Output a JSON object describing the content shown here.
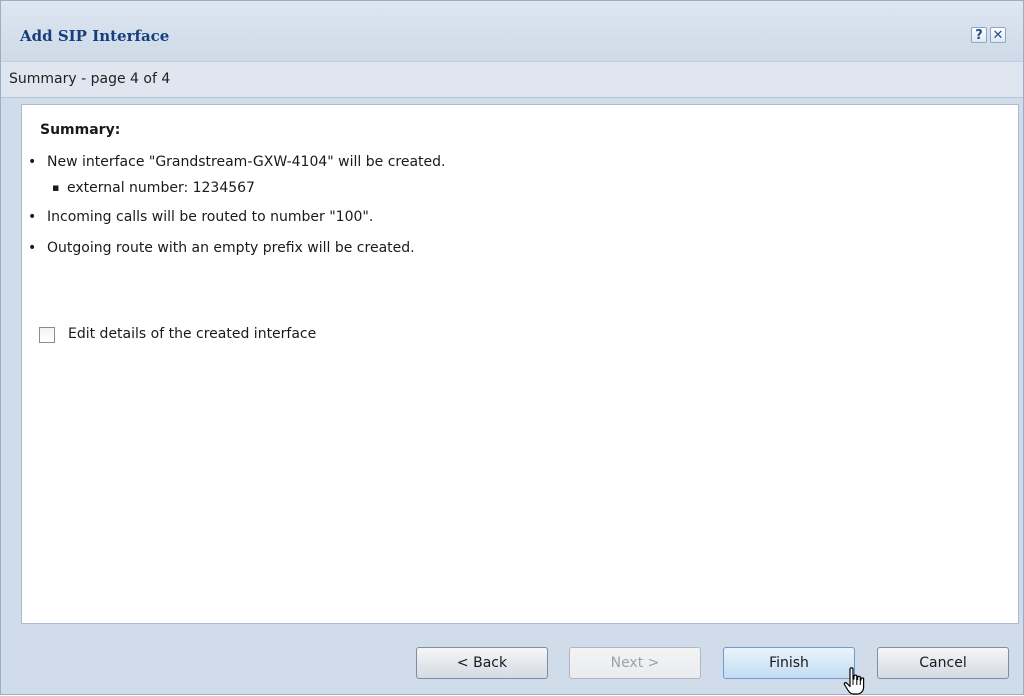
{
  "dialog": {
    "title": "Add SIP Interface",
    "help_glyph": "?",
    "close_glyph": "✕",
    "subtitle": "Summary - page 4 of 4"
  },
  "summary": {
    "heading": "Summary:",
    "bullet": "•",
    "sub_bullet": "▪",
    "items": [
      "New interface \"Grandstream-GXW-4104\" will be created.",
      "external number: 1234567",
      "Incoming calls will be routed to number \"100\".",
      "Outgoing route with an empty prefix will be created."
    ]
  },
  "edit_option": {
    "label": "Edit details of the created interface",
    "checked": false
  },
  "buttons": {
    "back": "< Back",
    "next": "Next >",
    "finish": "Finish",
    "cancel": "Cancel"
  },
  "icons": {
    "help": "help-icon",
    "close": "close-icon",
    "cursor": "hand-pointer-icon"
  },
  "colors": {
    "title_text": "#153e7e",
    "dialog_background": "#d0dcea",
    "hover_button": "#d4e7f7"
  }
}
